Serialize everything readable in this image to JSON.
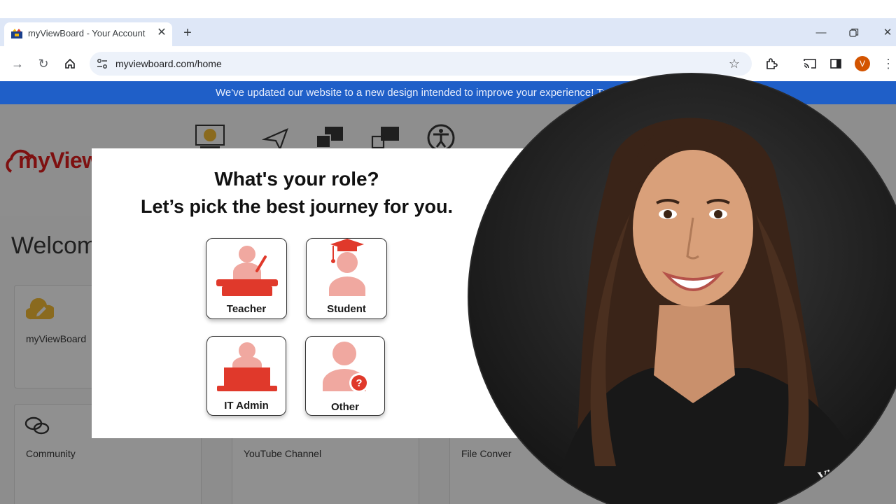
{
  "browser": {
    "tab_title": "myViewBoard - Your Account",
    "url": "myviewboard.com/home",
    "profile_initial": "V",
    "icons": [
      "favicon-icon",
      "close-icon",
      "plus-icon",
      "minimize-icon",
      "restore-icon",
      "window-close-icon",
      "forward-icon",
      "reload-icon",
      "home-icon",
      "site-settings-icon",
      "star-icon",
      "extensions-icon",
      "cast-icon",
      "side-panel-icon",
      "more-icon"
    ]
  },
  "site": {
    "banner": "We've updated our website to a new design intended to improve your experience! Tr",
    "logo_text": "myView",
    "welcome": "Welcom",
    "cards": {
      "myviewboard": "myViewBoard ",
      "community": "Community",
      "youtube": "YouTube Channel",
      "file_convert": "File Conver"
    }
  },
  "modal": {
    "question": "What's your role?",
    "subtitle": "Let’s pick the best journey for you.",
    "roles": [
      {
        "label": "Teacher",
        "icon": "teacher-icon"
      },
      {
        "label": "Student",
        "icon": "student-icon"
      },
      {
        "label": "IT Admin",
        "icon": "it-admin-icon"
      },
      {
        "label": "Other",
        "icon": "other-icon"
      }
    ]
  },
  "overlay": {
    "shirt_brand": "ViewSonic"
  },
  "colors": {
    "accent_red": "#e0392b",
    "accent_pink": "#f0a8a0",
    "banner_blue": "#1f5fc8",
    "logo_red": "#7e1010",
    "profile_orange": "#d35400"
  }
}
